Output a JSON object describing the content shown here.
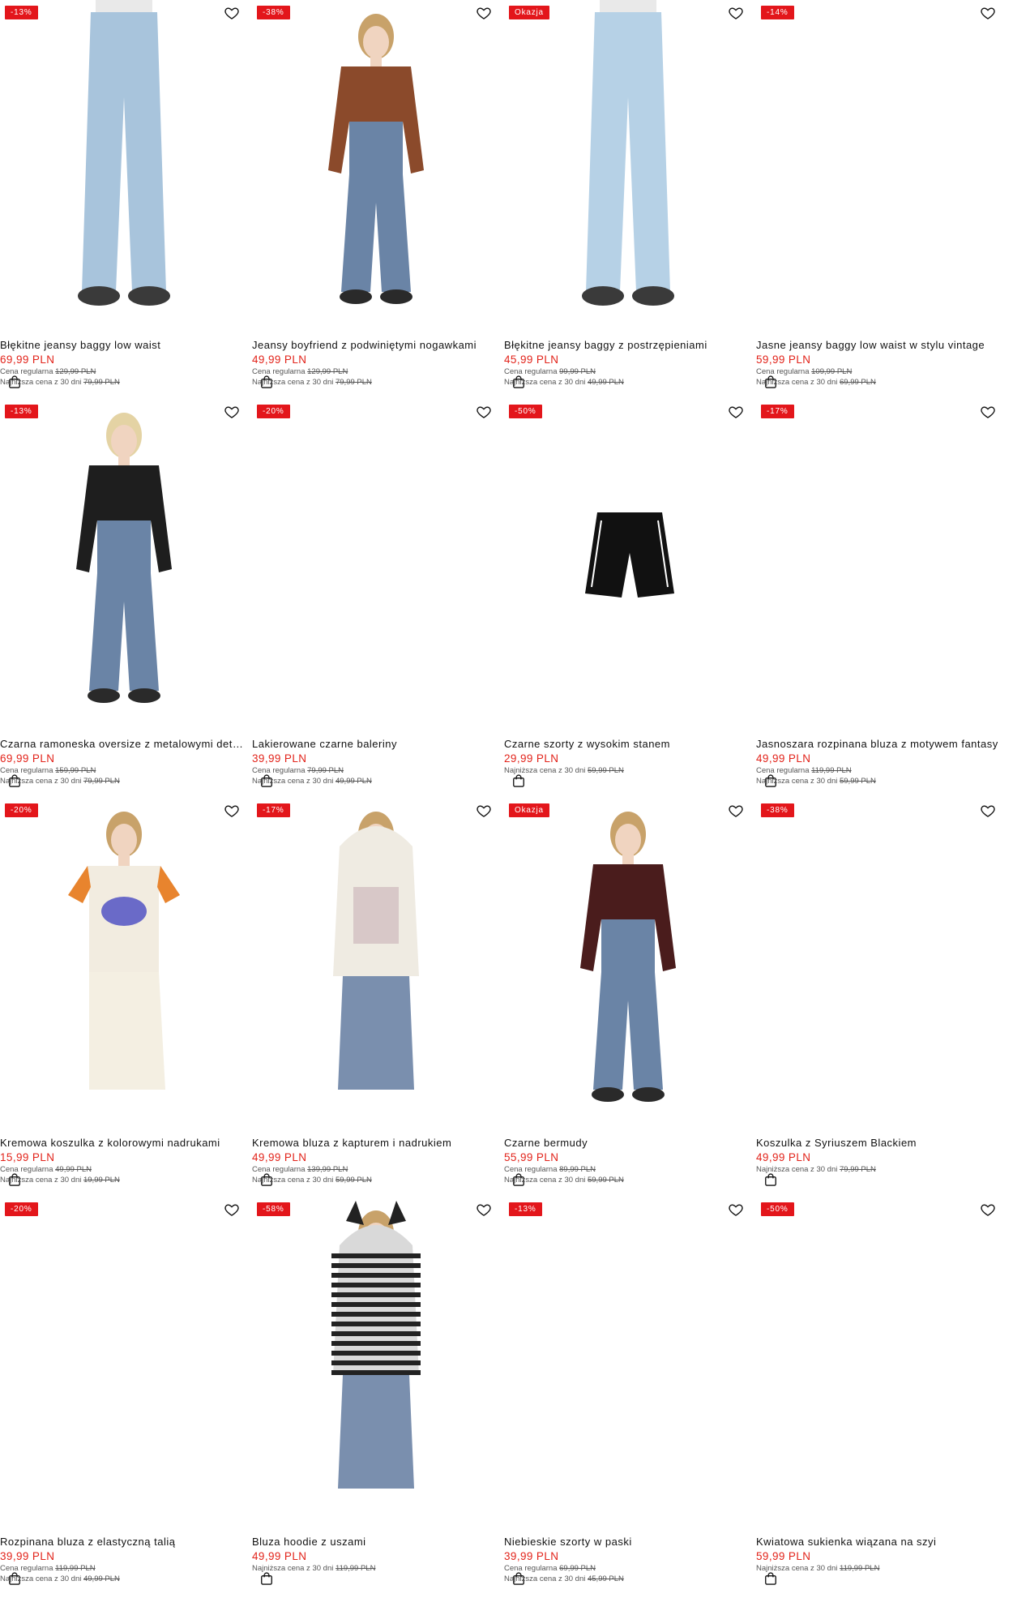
{
  "colors": {
    "badge": "#e3161b",
    "price": "#e2231a"
  },
  "icons": {
    "favorite": "heart-outline-icon",
    "cart": "shopping-bag-icon"
  },
  "products": [
    {
      "badge": "-13%",
      "name": "Błękitne jeansy baggy low waist",
      "price": "69,99 PLN",
      "regular_label": "Cena regularna",
      "regular_price": "129,99 PLN",
      "lowest_label": "Najniższa cena z 30 dni",
      "lowest_price": "79,99 PLN"
    },
    {
      "badge": "-38%",
      "name": "Jeansy boyfriend z podwiniętymi nogawkami",
      "price": "49,99 PLN",
      "regular_label": "Cena regularna",
      "regular_price": "129,99 PLN",
      "lowest_label": "Najniższa cena z 30 dni",
      "lowest_price": "79,99 PLN"
    },
    {
      "badge": "Okazja",
      "name": "Błękitne jeansy baggy z postrzępieniami",
      "price": "45,99 PLN",
      "regular_label": "Cena regularna",
      "regular_price": "99,99 PLN",
      "lowest_label": "Najniższa cena z 30 dni",
      "lowest_price": "49,99 PLN"
    },
    {
      "badge": "-14%",
      "name": "Jasne jeansy baggy low waist w stylu vintage",
      "price": "59,99 PLN",
      "regular_label": "Cena regularna",
      "regular_price": "109,99 PLN",
      "lowest_label": "Najniższa cena z 30 dni",
      "lowest_price": "69,99 PLN"
    },
    {
      "badge": "-13%",
      "name": "Czarna ramoneska oversize z metalowymi detalami",
      "price": "69,99 PLN",
      "regular_label": "Cena regularna",
      "regular_price": "159,99 PLN",
      "lowest_label": "Najniższa cena z 30 dni",
      "lowest_price": "79,99 PLN"
    },
    {
      "badge": "-20%",
      "name": "Lakierowane czarne baleriny",
      "price": "39,99 PLN",
      "regular_label": "Cena regularna",
      "regular_price": "79,99 PLN",
      "lowest_label": "Najniższa cena z 30 dni",
      "lowest_price": "49,99 PLN"
    },
    {
      "badge": "-50%",
      "name": "Czarne szorty z wysokim stanem",
      "price": "29,99 PLN",
      "regular_label": "",
      "regular_price": "",
      "lowest_label": "Najniższa cena z 30 dni",
      "lowest_price": "59,99 PLN"
    },
    {
      "badge": "-17%",
      "name": "Jasnoszara rozpinana bluza z motywem fantasy",
      "price": "49,99 PLN",
      "regular_label": "Cena regularna",
      "regular_price": "119,99 PLN",
      "lowest_label": "Najniższa cena z 30 dni",
      "lowest_price": "59,99 PLN"
    },
    {
      "badge": "-20%",
      "name": "Kremowa koszulka z kolorowymi nadrukami",
      "price": "15,99 PLN",
      "regular_label": "Cena regularna",
      "regular_price": "49,99 PLN",
      "lowest_label": "Najniższa cena z 30 dni",
      "lowest_price": "19,99 PLN"
    },
    {
      "badge": "-17%",
      "name": "Kremowa bluza z kapturem i nadrukiem",
      "price": "49,99 PLN",
      "regular_label": "Cena regularna",
      "regular_price": "139,99 PLN",
      "lowest_label": "Najniższa cena z 30 dni",
      "lowest_price": "59,99 PLN"
    },
    {
      "badge": "Okazja",
      "name": "Czarne bermudy",
      "price": "55,99 PLN",
      "regular_label": "Cena regularna",
      "regular_price": "89,99 PLN",
      "lowest_label": "Najniższa cena z 30 dni",
      "lowest_price": "59,99 PLN"
    },
    {
      "badge": "-38%",
      "name": "Koszulka z Syriuszem Blackiem",
      "price": "49,99 PLN",
      "regular_label": "",
      "regular_price": "",
      "lowest_label": "Najniższa cena z 30 dni",
      "lowest_price": "79,99 PLN"
    },
    {
      "badge": "-20%",
      "name": "Rozpinana bluza z elastyczną talią",
      "price": "39,99 PLN",
      "regular_label": "Cena regularna",
      "regular_price": "119,99 PLN",
      "lowest_label": "Najniższa cena z 30 dni",
      "lowest_price": "49,99 PLN"
    },
    {
      "badge": "-58%",
      "name": "Bluza hoodie z uszami",
      "price": "49,99 PLN",
      "regular_label": "",
      "regular_price": "",
      "lowest_label": "Najniższa cena z 30 dni",
      "lowest_price": "119,99 PLN"
    },
    {
      "badge": "-13%",
      "name": "Niebieskie szorty w paski",
      "price": "39,99 PLN",
      "regular_label": "Cena regularna",
      "regular_price": "69,99 PLN",
      "lowest_label": "Najniższa cena z 30 dni",
      "lowest_price": "45,99 PLN"
    },
    {
      "badge": "-50%",
      "name": "Kwiatowa sukienka wiązana na szyi",
      "price": "59,99 PLN",
      "regular_label": "",
      "regular_price": "",
      "lowest_label": "Najniższa cena z 30 dni",
      "lowest_price": "119,99 PLN"
    }
  ]
}
